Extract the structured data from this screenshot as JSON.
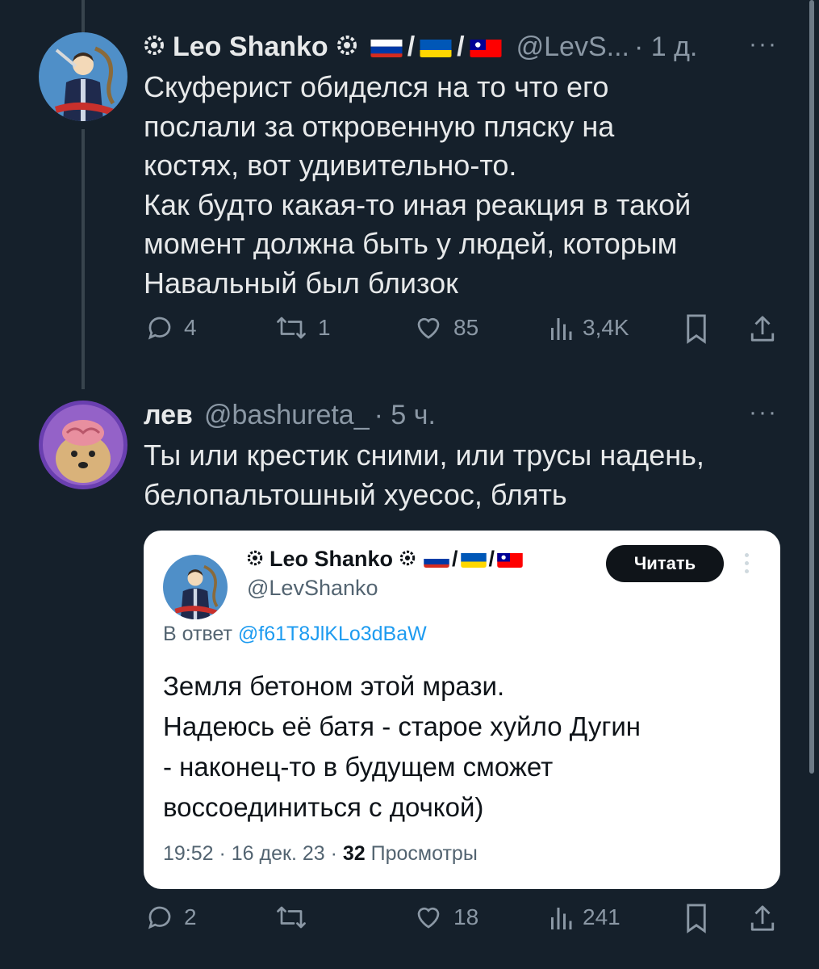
{
  "colors": {
    "background": "#15202b",
    "text": "#e7e9ea",
    "muted": "#8b98a5",
    "link": "#1d9bf0"
  },
  "tweet1": {
    "name": "Leo Shanko",
    "handle": "@LevS...",
    "time": "· 1 д.",
    "text": [
      "Скуферист обиделся на то что его",
      "послали за откровенную пляску на",
      "костях, вот удивительно-то.",
      "Как будто какая-то иная реакция в такой",
      "момент должна быть у людей, которым",
      "Навальный был близок"
    ],
    "replies": "4",
    "retweets": "1",
    "likes": "85",
    "views": "3,4K"
  },
  "tweet2": {
    "name": "лев",
    "handle": "@bashureta_",
    "time": "· 5 ч.",
    "text": [
      "Ты или крестик сними, или трусы надень,",
      "белопальтошный хуесос, блять"
    ],
    "replies": "2",
    "retweets": "",
    "likes": "18",
    "views": "241"
  },
  "quote": {
    "name": "Leo Shanko",
    "handle": "@LevShanko",
    "follow_label": "Читать",
    "reply_prefix": "В ответ",
    "reply_to": "@f61T8JlKLo3dBaW",
    "text": [
      "Земля бетоном этой мрази.",
      "Надеюсь её батя - старое хуйло Дугин",
      "- наконец-то в будущем сможет",
      "воссоединиться с дочкой)"
    ],
    "timestamp": "19:52 · 16 дек. 23 ·",
    "views_count": "32",
    "views_label": "Просмотры"
  },
  "icons": [
    "reply-icon",
    "retweet-icon",
    "like-icon",
    "views-icon",
    "bookmark-icon",
    "share-icon",
    "more-icon"
  ]
}
